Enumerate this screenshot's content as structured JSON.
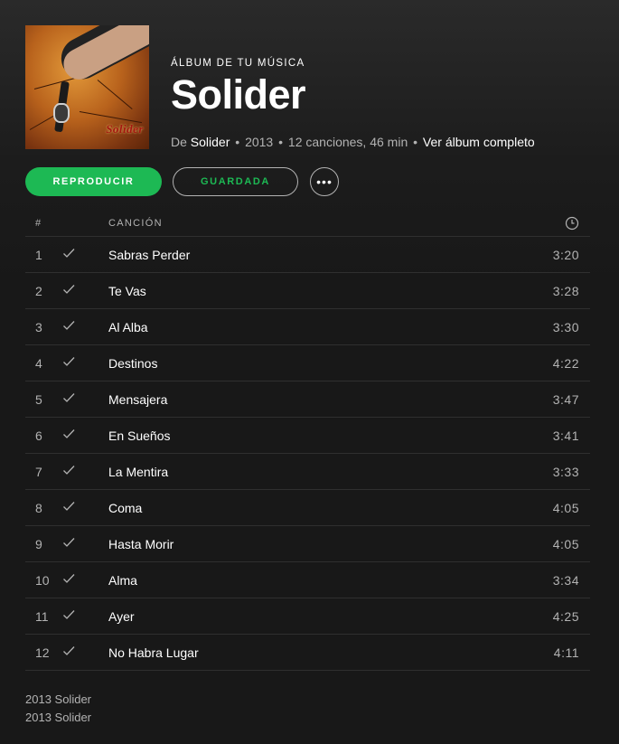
{
  "album": {
    "kicker": "ÁLBUM DE TU MÚSICA",
    "title": "Solider",
    "cover_logo": "Solider",
    "by_prefix": "De",
    "artist": "Solider",
    "year": "2013",
    "stats": "12 canciones, 46 min",
    "full_album_link": "Ver álbum completo"
  },
  "actions": {
    "play_label": "REPRODUCIR",
    "saved_label": "GUARDADA",
    "more_label": "•••"
  },
  "table": {
    "col_number": "#",
    "col_title": "CANCIÓN",
    "col_duration_icon": "clock-icon"
  },
  "tracks": [
    {
      "number": "1",
      "title": "Sabras Perder",
      "duration": "3:20"
    },
    {
      "number": "2",
      "title": "Te Vas",
      "duration": "3:28"
    },
    {
      "number": "3",
      "title": "Al Alba",
      "duration": "3:30"
    },
    {
      "number": "4",
      "title": "Destinos",
      "duration": "4:22"
    },
    {
      "number": "5",
      "title": "Mensajera",
      "duration": "3:47"
    },
    {
      "number": "6",
      "title": "En Sueños",
      "duration": "3:41"
    },
    {
      "number": "7",
      "title": "La Mentira",
      "duration": "3:33"
    },
    {
      "number": "8",
      "title": "Coma",
      "duration": "4:05"
    },
    {
      "number": "9",
      "title": "Hasta Morir",
      "duration": "4:05"
    },
    {
      "number": "10",
      "title": "Alma",
      "duration": "3:34"
    },
    {
      "number": "11",
      "title": "Ayer",
      "duration": "4:25"
    },
    {
      "number": "12",
      "title": "No Habra Lugar",
      "duration": "4:11"
    }
  ],
  "footer": {
    "copyright_1": "2013 Solider",
    "copyright_2": "2013 Solider"
  },
  "colors": {
    "accent": "#1db954",
    "background": "#181818",
    "muted_text": "#b3b3b3"
  }
}
